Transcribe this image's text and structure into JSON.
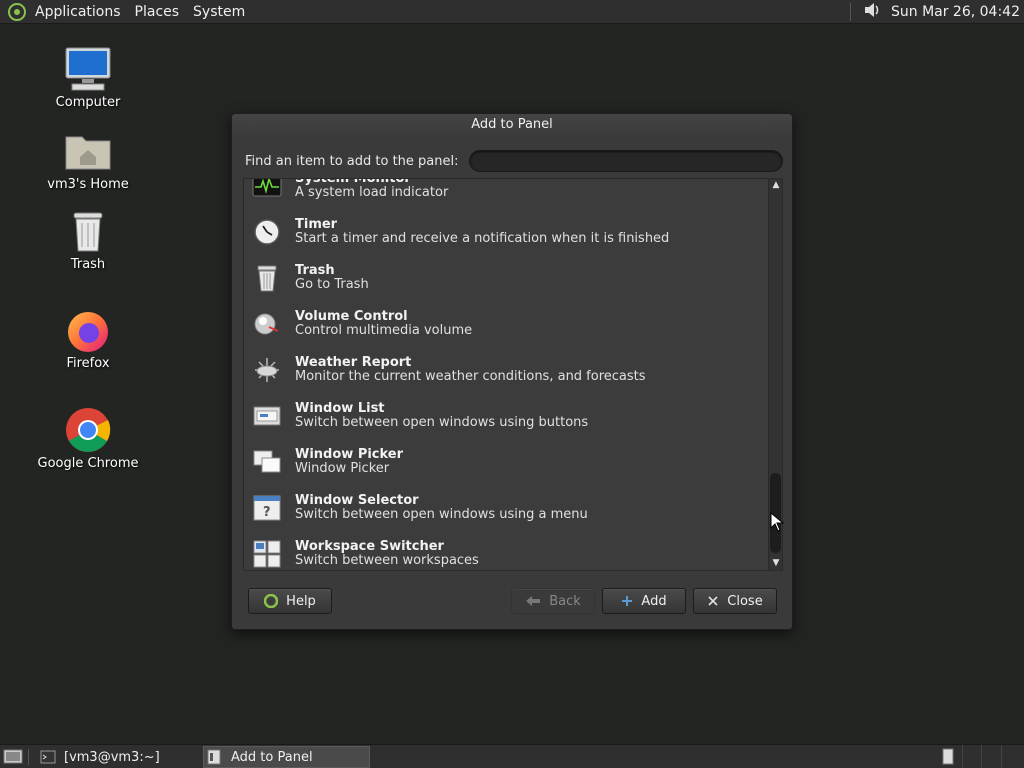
{
  "top_panel": {
    "menus": [
      "Applications",
      "Places",
      "System"
    ],
    "clock": "Sun Mar 26, 04:42"
  },
  "desktop_icons": [
    {
      "label": "Computer",
      "icon": "computer-icon"
    },
    {
      "label": "vm3's Home",
      "icon": "home-folder-icon"
    },
    {
      "label": "Trash",
      "icon": "trash-icon"
    },
    {
      "label": "Firefox",
      "icon": "firefox-icon"
    },
    {
      "label": "Google Chrome",
      "icon": "chrome-icon"
    }
  ],
  "dialog": {
    "title": "Add to Panel",
    "search_label": "Find an item to add to the panel:",
    "search_value": "",
    "items": [
      {
        "name": "System Monitor",
        "desc": "A system load indicator",
        "icon": "system-monitor-icon"
      },
      {
        "name": "Timer",
        "desc": "Start a timer and receive a notification when it is finished",
        "icon": "timer-icon"
      },
      {
        "name": "Trash",
        "desc": "Go to Trash",
        "icon": "trash-icon"
      },
      {
        "name": "Volume Control",
        "desc": "Control multimedia volume",
        "icon": "volume-icon"
      },
      {
        "name": "Weather Report",
        "desc": "Monitor the current weather conditions, and forecasts",
        "icon": "weather-icon"
      },
      {
        "name": "Window List",
        "desc": "Switch between open windows using buttons",
        "icon": "window-list-icon"
      },
      {
        "name": "Window Picker",
        "desc": "Window Picker",
        "icon": "window-picker-icon"
      },
      {
        "name": "Window Selector",
        "desc": "Switch between open windows using a menu",
        "icon": "window-selector-icon"
      },
      {
        "name": "Workspace Switcher",
        "desc": "Switch between workspaces",
        "icon": "workspace-switcher-icon"
      }
    ],
    "buttons": {
      "help": "Help",
      "back": "Back",
      "add": "Add",
      "close": "Close"
    }
  },
  "taskbar": {
    "tasks": [
      "[vm3@vm3:~]",
      "Add to Panel"
    ]
  }
}
